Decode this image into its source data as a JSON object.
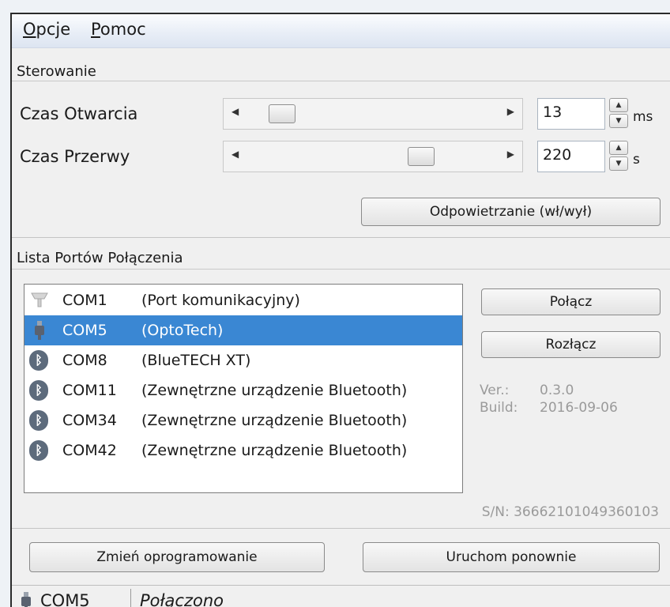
{
  "menu": {
    "items": [
      {
        "label_first": "O",
        "label_rest": "pcje"
      },
      {
        "label_first": "P",
        "label_rest": "omoc"
      }
    ]
  },
  "control": {
    "group_title": "Sterowanie",
    "open_time": {
      "label": "Czas Otwarcia",
      "value": "13",
      "unit": "ms"
    },
    "pause_time": {
      "label": "Czas Przerwy",
      "value": "220",
      "unit": "s"
    },
    "bleed_button": "Odpowietrzanie (wł/wył)"
  },
  "ports": {
    "group_title": "Lista Portów Połączenia",
    "items": [
      {
        "port": "COM1",
        "desc": "(Port komunikacyjny)",
        "icon": "serial-port-icon",
        "selected": false
      },
      {
        "port": "COM5",
        "desc": "(OptoTech)",
        "icon": "usb-plug-icon",
        "selected": true
      },
      {
        "port": "COM8",
        "desc": "(BlueTECH XT)",
        "icon": "bluetooth-icon",
        "selected": false
      },
      {
        "port": "COM11",
        "desc": "(Zewnętrzne urządzenie Bluetooth)",
        "icon": "bluetooth-icon",
        "selected": false
      },
      {
        "port": "COM34",
        "desc": "(Zewnętrzne urządzenie Bluetooth)",
        "icon": "bluetooth-icon",
        "selected": false
      },
      {
        "port": "COM42",
        "desc": "(Zewnętrzne urządzenie Bluetooth)",
        "icon": "bluetooth-icon",
        "selected": false
      }
    ],
    "connect_button": "Połącz",
    "disconnect_button": "Rozłącz",
    "version_label": "Ver.:",
    "version_value": "0.3.0",
    "build_label": "Build:",
    "build_value": "2016-09-06",
    "serial": "S/N: 36662101049360103"
  },
  "bottom": {
    "firmware_button": "Zmień oprogramowanie",
    "restart_button": "Uruchom ponownie"
  },
  "status": {
    "port": "COM5",
    "state": "Połączono"
  },
  "colors": {
    "selection": "#3a87d3",
    "bluetooth_icon": "#5d6b7c"
  }
}
